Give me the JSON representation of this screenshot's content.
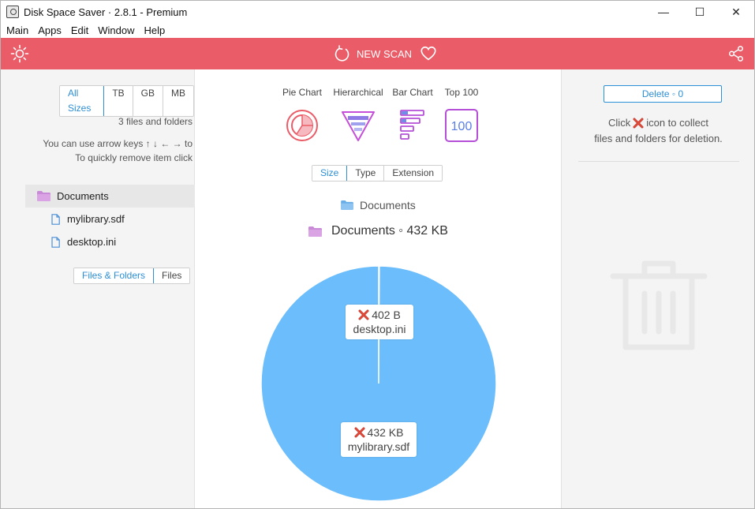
{
  "window": {
    "title": "Disk Space Saver · 2.8.1 - Premium",
    "controls": {
      "minimize": "—",
      "maximize": "☐",
      "close": "✕"
    }
  },
  "menu": [
    "Main",
    "Apps",
    "Edit",
    "Window",
    "Help"
  ],
  "toolbar": {
    "scan_label": "NEW SCAN",
    "accent_color": "#ea5c68"
  },
  "left": {
    "size_filters": [
      "All Sizes",
      "TB",
      "GB",
      "MB"
    ],
    "size_filter_selected": "All Sizes",
    "count_text": "3 files and folders",
    "hint_line1": "You can use arrow keys ↑ ↓ ← → to",
    "hint_line2": "To quickly remove item click",
    "tree": [
      {
        "name": "Documents",
        "type": "folder"
      },
      {
        "name": "mylibrary.sdf",
        "type": "file"
      },
      {
        "name": "desktop.ini",
        "type": "file"
      }
    ],
    "view_filters": [
      "Files & Folders",
      "Files"
    ],
    "view_filter_selected": "Files & Folders"
  },
  "center": {
    "view_tabs": [
      {
        "label": "Pie Chart",
        "icon": "pie-chart-icon"
      },
      {
        "label": "Hierarchical",
        "icon": "hierarchical-icon"
      },
      {
        "label": "Bar Chart",
        "icon": "bar-chart-icon"
      },
      {
        "label": "Top 100",
        "icon": "top-100-icon",
        "icon_text": "100"
      }
    ],
    "group_filters": [
      "Size",
      "Type",
      "Extension"
    ],
    "group_filter_selected": "Size",
    "breadcrumb_folder": "Documents",
    "current_folder": "Documents ◦ 432 KB",
    "pie_color": "#6bbdfb",
    "pie_slices": [
      {
        "name": "mylibrary.sdf",
        "size_label": "432 KB",
        "bytes": 442368
      },
      {
        "name": "desktop.ini",
        "size_label": "402 B",
        "bytes": 402
      }
    ]
  },
  "right": {
    "delete_label": "Delete ◦ 0",
    "hint_pre": "Click",
    "hint_post": "icon to collect",
    "hint_line2": "files and folders for deletion."
  }
}
